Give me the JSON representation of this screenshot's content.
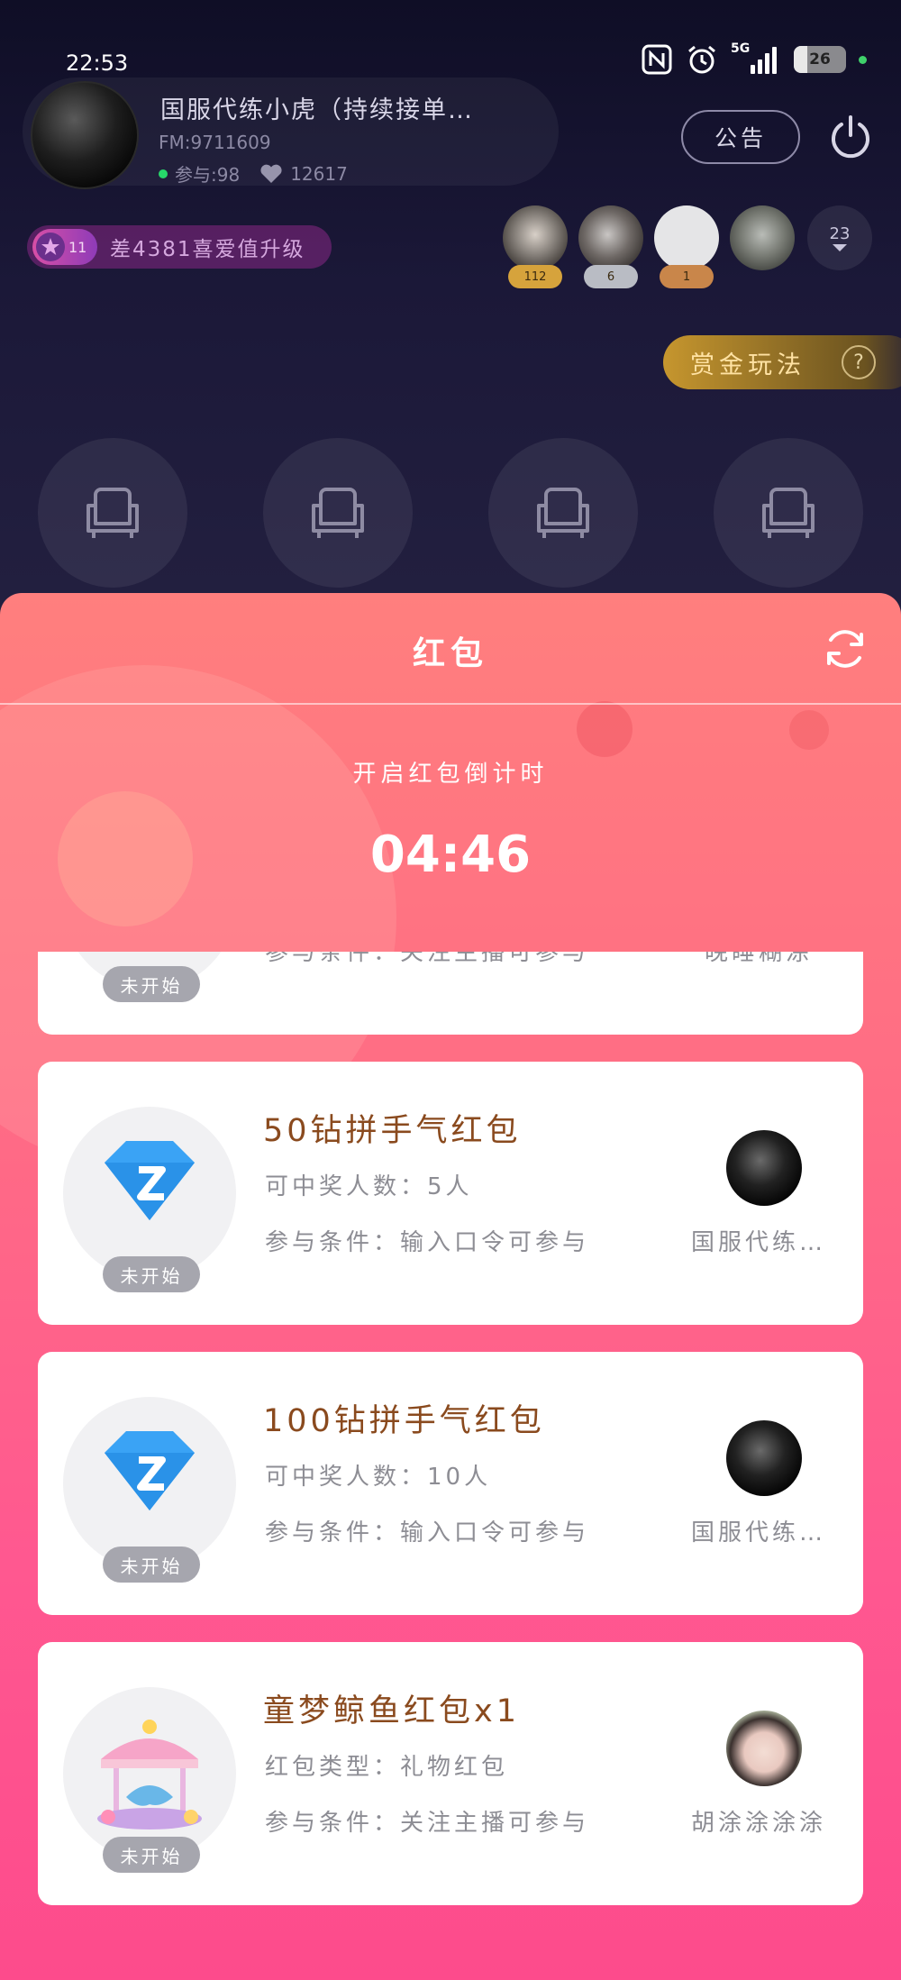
{
  "status_bar": {
    "time": "22:53",
    "network": "5G",
    "battery": "26",
    "battery_level": 0.26
  },
  "room": {
    "host_name": "国服代练小虎（持续接单…",
    "fm_id": "FM:9711609",
    "participants": "参与:98",
    "likes": "12617",
    "notice_button": "公告",
    "level_number": "11",
    "level_progress_text": "差4381喜爱值升级",
    "viewers": [
      {
        "count": "112",
        "badge_color": "#d6a33c"
      },
      {
        "count": "6",
        "badge_color": "#b9bcc4"
      },
      {
        "count": "1",
        "badge_color": "#c9864a"
      },
      {
        "count": "",
        "badge_color": ""
      }
    ],
    "more_viewers_count": "23",
    "bounty_button": "赏金玩法",
    "bounty_help": "?"
  },
  "sheet": {
    "title": "红包",
    "countdown_label": "开启红包倒计时",
    "countdown": "04:46",
    "cards": [
      {
        "title": "",
        "line1": "",
        "line2": "参与条件：关注主播可参与",
        "sender": "晚睡糊涂",
        "status": "未开始"
      },
      {
        "title": "50钻拼手气红包",
        "line1": "可中奖人数：5人",
        "line2": "参与条件：输入口令可参与",
        "sender": "国服代练…",
        "status": "未开始",
        "icon": "diamond-icon"
      },
      {
        "title": "100钻拼手气红包",
        "line1": "可中奖人数：10人",
        "line2": "参与条件：输入口令可参与",
        "sender": "国服代练…",
        "status": "未开始",
        "icon": "diamond-icon"
      },
      {
        "title": "童梦鲸鱼红包x1",
        "line1": "红包类型：礼物红包",
        "line2": "参与条件：关注主播可参与",
        "sender": "胡涂涂涂涂",
        "status": "未开始",
        "icon": "carousel-gift-icon"
      }
    ]
  },
  "colors": {
    "sheet_top": "#ff7f7e",
    "sheet_bottom": "#fd4b8c",
    "card_title": "#8a4a1e",
    "muted_text": "#8d8d94",
    "status_badge": "#a6a6ae",
    "diamond": "#3aa3f5"
  }
}
